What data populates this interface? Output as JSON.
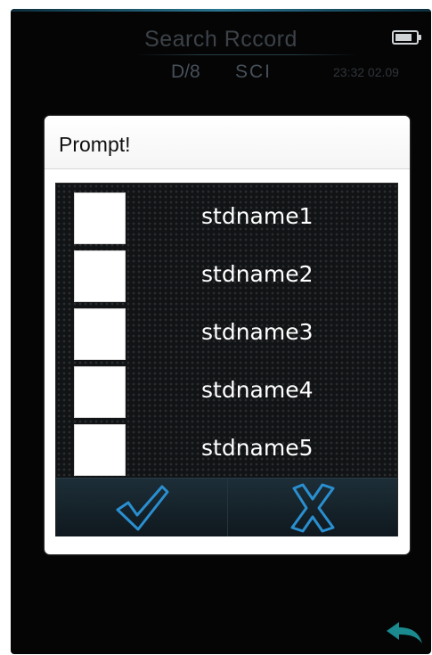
{
  "screen": {
    "title": "Search Rccord",
    "measure_geometry": "D/8",
    "measure_mode": "SCI",
    "clock": "23:32 02.09",
    "battery_icon": "battery-icon"
  },
  "dialog": {
    "title": "Prompt!",
    "options": [
      {
        "label": "stdname1",
        "checked": true
      },
      {
        "label": "stdname2",
        "checked": false
      },
      {
        "label": "stdname3",
        "checked": false
      },
      {
        "label": "stdname4",
        "checked": false
      },
      {
        "label": "stdname5",
        "checked": false
      }
    ],
    "confirm_icon": "checkmark-icon",
    "cancel_icon": "cross-icon"
  },
  "nav": {
    "back_icon": "back-arrow-icon"
  },
  "colors": {
    "accent": "#1f6fa8",
    "button_outline": "#2a8fd0",
    "back_arrow": "#1a8a8f",
    "background": "#050505"
  }
}
